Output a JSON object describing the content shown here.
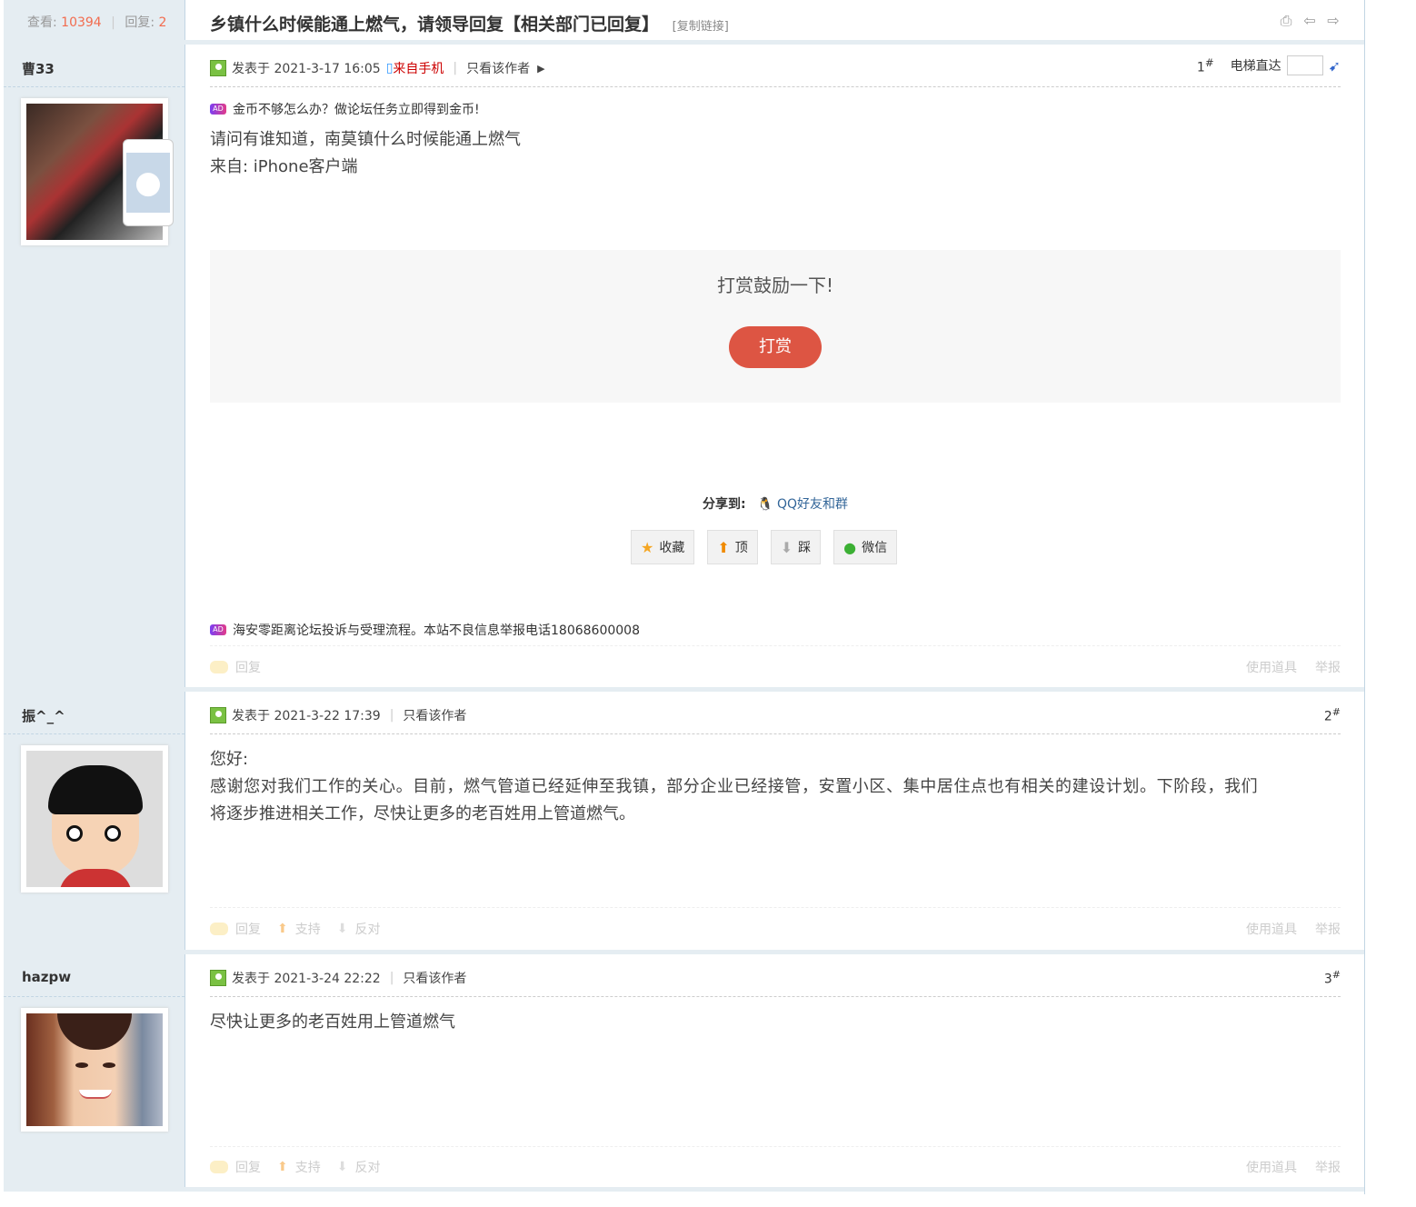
{
  "thread": {
    "stats": {
      "views_label": "查看:",
      "views": "10394",
      "replies_label": "回复:",
      "replies": "2"
    },
    "title": "乡镇什么时候能通上燃气，请领导回复【相关部门已回复】",
    "copy_link": "[复制链接]",
    "header_icons": [
      "printer-icon",
      "prev-arrow-icon",
      "next-arrow-icon"
    ]
  },
  "elevator": {
    "label": "电梯直达"
  },
  "posts": [
    {
      "author": "曹33",
      "posted": "发表于 2021-3-17 16:05",
      "mobile": "来自手机",
      "only_author": "只看该作者",
      "floor": "1",
      "ad_top": "金币不够怎么办？做论坛任务立即得到金币!",
      "lines": [
        "请问有谁知道，南莫镇什么时候能通上燃气",
        "来自: iPhone客户端"
      ],
      "reward_text": "打赏鼓励一下!",
      "reward_button": "打赏",
      "share_label": "分享到:",
      "share_qq": "QQ好友和群",
      "actions": [
        "收藏",
        "顶",
        "踩",
        "微信"
      ],
      "ad_bottom": "海安零距离论坛投诉与受理流程。本站不良信息举报电话18068600008",
      "reply": "回复",
      "tools": "使用道具",
      "report": "举报"
    },
    {
      "author": "振^_^",
      "posted": "发表于 2021-3-22 17:39",
      "only_author": "只看该作者",
      "floor": "2",
      "lines": [
        "您好:",
        "感谢您对我们工作的关心。目前，燃气管道已经延伸至我镇，部分企业已经接管，安置小区、集中居住点也有相关的建设计划。下阶段，我们",
        "将逐步推进相关工作，尽快让更多的老百姓用上管道燃气。"
      ],
      "reply": "回复",
      "support": "支持",
      "oppose": "反对",
      "tools": "使用道具",
      "report": "举报"
    },
    {
      "author": "hazpw",
      "posted": "发表于 2021-3-24 22:22",
      "only_author": "只看该作者",
      "floor": "3",
      "lines": [
        "尽快让更多的老百姓用上管道燃气"
      ],
      "reply": "回复",
      "support": "支持",
      "oppose": "反对",
      "tools": "使用道具",
      "report": "举报"
    }
  ],
  "colors": {
    "accent": "#f26c4f",
    "reward": "#dd5543",
    "sidebar": "#e5edf2",
    "link": "#336699"
  }
}
